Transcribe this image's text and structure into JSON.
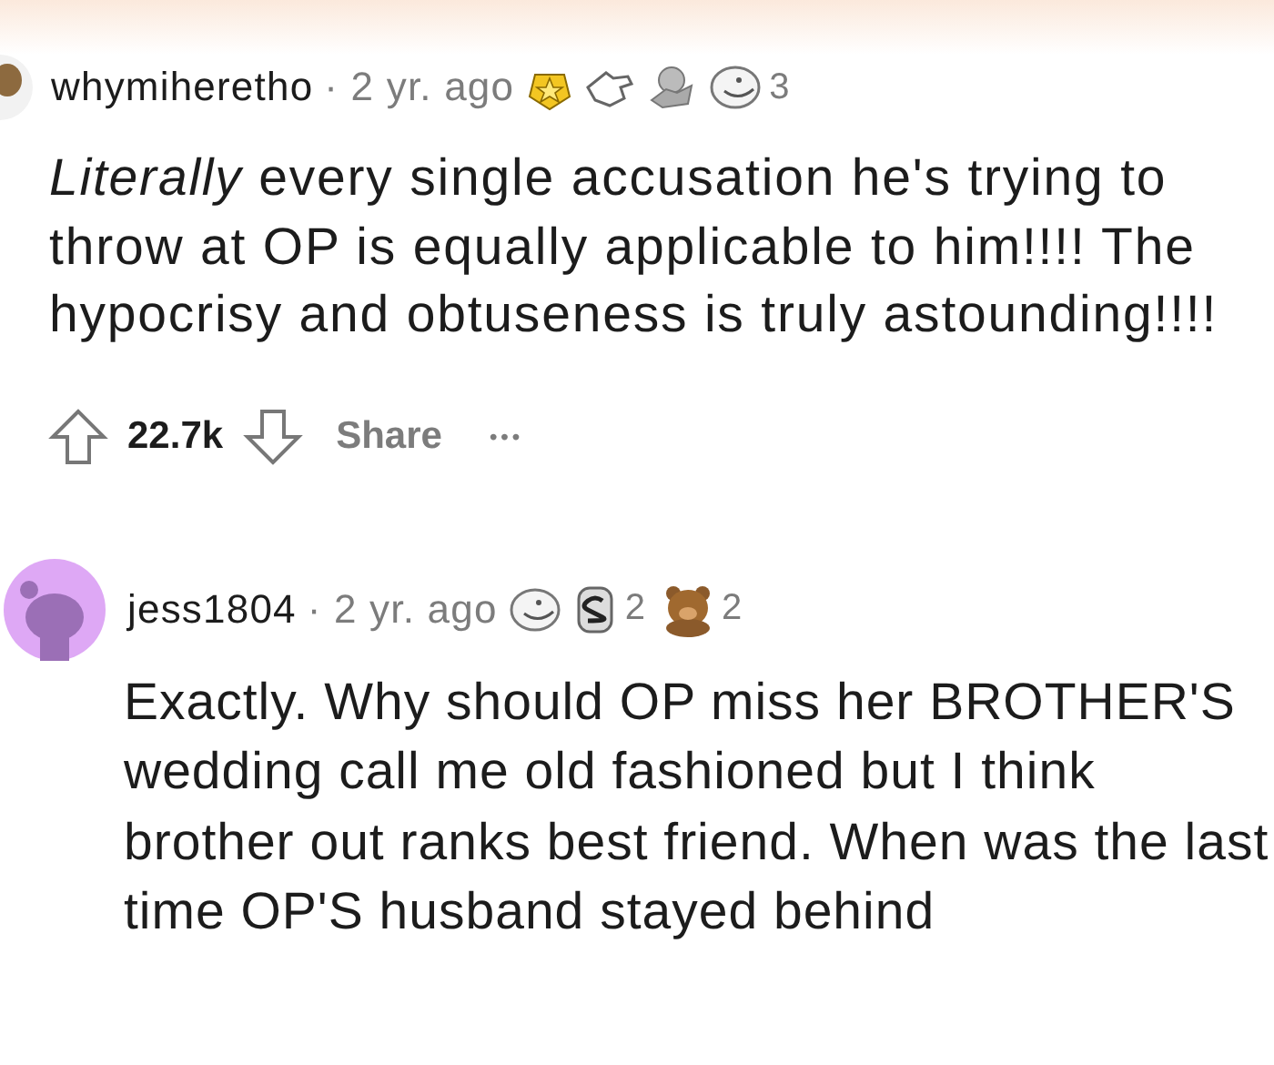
{
  "comments": [
    {
      "username": "whymiheretho",
      "time": "· 2 yr. ago",
      "avatar": {
        "kind": "partial"
      },
      "awards": [
        {
          "kind": "star-badge"
        },
        {
          "kind": "hand"
        },
        {
          "kind": "hug"
        },
        {
          "kind": "face",
          "count": "3"
        }
      ],
      "body": "*Literally* every single accusation he's trying to throw at OP is equally applicable to him!!!! The hypocrisy and obtuseness is truly astounding!!!!",
      "votes": "22.7k",
      "share": "Share",
      "more": "•••"
    },
    {
      "username": "jess1804",
      "time": "· 2 yr. ago",
      "avatar": {
        "kind": "full"
      },
      "awards": [
        {
          "kind": "face"
        },
        {
          "kind": "jar",
          "count": "2"
        },
        {
          "kind": "bear",
          "count": "2"
        }
      ],
      "body": "Exactly. Why should OP miss her BROTHER'S wedding call me old fashioned but I think brother out ranks best friend. When was the last time OP'S husband stayed behind"
    }
  ]
}
